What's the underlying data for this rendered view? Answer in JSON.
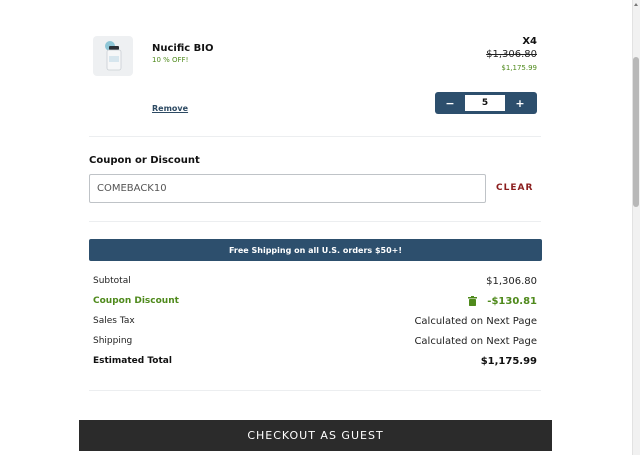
{
  "cart_item": {
    "name": "Nucific BIO",
    "promo": "10 % OFF!",
    "quantity_multiplier": "X4",
    "price_original": "$1,306.80",
    "price_discounted": "$1,175.99",
    "remove_label": "Remove",
    "thumbnail_icon": "product-bottle-icon",
    "stepper": {
      "decrement_label": "−",
      "value": "5",
      "increment_label": "+"
    }
  },
  "coupon": {
    "title": "Coupon or Discount",
    "input_value": "COMEBACK10",
    "clear_label": "CLEAR"
  },
  "shipping_banner": "Free Shipping on all U.S. orders $50+!",
  "summary": {
    "subtotal_label": "Subtotal",
    "subtotal_value": "$1,306.80",
    "coupon_label": "Coupon Discount",
    "coupon_value": "-$130.81",
    "coupon_icon": "trash-icon",
    "tax_label": "Sales Tax",
    "tax_value": "Calculated on Next Page",
    "shipping_label": "Shipping",
    "shipping_value": "Calculated on Next Page",
    "total_label": "Estimated Total",
    "total_value": "$1,175.99"
  },
  "checkout_label": "CHECKOUT AS GUEST",
  "colors": {
    "brand_navy": "#2d4f6d",
    "discount_green": "#4f8a1c",
    "clear_red": "#8b1d1d",
    "checkout_dark": "#2b2b2b"
  }
}
